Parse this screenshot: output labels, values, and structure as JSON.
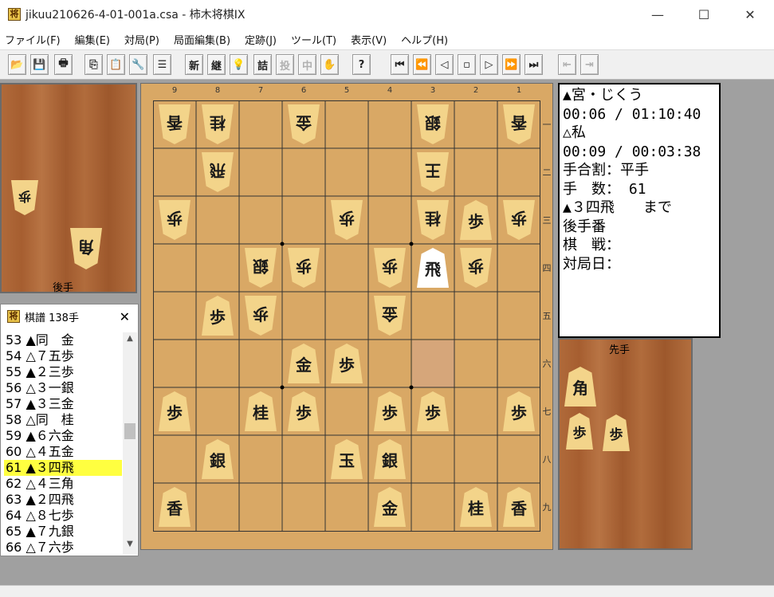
{
  "window": {
    "title": "jikuu210626-4-01-001a.csa - 柿木将棋IX",
    "app_icon": "将",
    "min_glyph": "—",
    "max_glyph": "☐",
    "close_glyph": "✕"
  },
  "menu": [
    "ファイル(F)",
    "編集(E)",
    "対局(P)",
    "局面編集(B)",
    "定跡(J)",
    "ツール(T)",
    "表示(V)",
    "ヘルプ(H)"
  ],
  "toolbar": {
    "buttons": [
      {
        "name": "open-icon",
        "glyph": "📂",
        "enabled": true
      },
      {
        "name": "save-icon",
        "glyph": "💾",
        "enabled": true
      },
      {
        "name": "print-icon",
        "glyph": "🖶",
        "enabled": true
      },
      {
        "name": "copy-icon",
        "glyph": "⎘",
        "enabled": true
      },
      {
        "name": "paste-icon",
        "glyph": "📋",
        "enabled": true
      },
      {
        "name": "tools-icon",
        "glyph": "🔧",
        "enabled": true
      },
      {
        "name": "list-icon",
        "glyph": "☰",
        "enabled": true
      },
      {
        "name": "new-game-button",
        "glyph": "新",
        "enabled": true
      },
      {
        "name": "continue-button",
        "glyph": "継",
        "enabled": true
      },
      {
        "name": "hint-icon",
        "glyph": "💡",
        "enabled": true
      },
      {
        "name": "tsume-button",
        "glyph": "詰",
        "enabled": true
      },
      {
        "name": "resign-button",
        "glyph": "投",
        "enabled": false
      },
      {
        "name": "interrupt-button",
        "glyph": "中",
        "enabled": false
      },
      {
        "name": "hand-icon",
        "glyph": "✋",
        "enabled": false
      },
      {
        "name": "help-icon",
        "glyph": "?",
        "enabled": true
      },
      {
        "name": "first-move-icon",
        "glyph": "⏮",
        "enabled": true
      },
      {
        "name": "back-many-icon",
        "glyph": "⏪",
        "enabled": true
      },
      {
        "name": "back-one-icon",
        "glyph": "◁",
        "enabled": true
      },
      {
        "name": "stop-icon",
        "glyph": "▫",
        "enabled": true
      },
      {
        "name": "forward-one-icon",
        "glyph": "▷",
        "enabled": true
      },
      {
        "name": "forward-many-icon",
        "glyph": "⏩",
        "enabled": true
      },
      {
        "name": "last-move-icon",
        "glyph": "⏭",
        "enabled": true
      },
      {
        "name": "branch-back-icon",
        "glyph": "⇤",
        "enabled": false
      },
      {
        "name": "branch-forward-icon",
        "glyph": "⇥",
        "enabled": false
      }
    ]
  },
  "gote_stand": {
    "label": "後手",
    "pieces": [
      "歩",
      "角"
    ]
  },
  "sente_stand": {
    "label": "先手",
    "pieces": [
      "角",
      "歩",
      "歩"
    ]
  },
  "kifu": {
    "title": "棋譜 138手",
    "icon": "将",
    "close_glyph": "✕",
    "up_glyph": "▲",
    "down_glyph": "▼",
    "selected_index": 8,
    "moves": [
      "53 ▲同　金",
      "54 △７五歩",
      "55 ▲２三歩",
      "56 △３一銀",
      "57 ▲３三金",
      "58 △同　桂",
      "59 ▲６六金",
      "60 △４五金",
      "61 ▲３四飛",
      "62 △４三角",
      "63 ▲２四飛",
      "64 △８七歩",
      "65 ▲７九銀",
      "66 △７六歩"
    ]
  },
  "board": {
    "file_labels": [
      "9",
      "8",
      "7",
      "6",
      "5",
      "4",
      "3",
      "2",
      "1"
    ],
    "rank_labels": [
      "一",
      "二",
      "三",
      "四",
      "五",
      "六",
      "七",
      "八",
      "九"
    ],
    "highlight_square": {
      "file": 3,
      "rank": 6
    },
    "pieces": [
      {
        "file": 9,
        "rank": 1,
        "kanji": "香",
        "side": "gote"
      },
      {
        "file": 8,
        "rank": 1,
        "kanji": "桂",
        "side": "gote"
      },
      {
        "file": 6,
        "rank": 1,
        "kanji": "金",
        "side": "gote"
      },
      {
        "file": 3,
        "rank": 1,
        "kanji": "銀",
        "side": "gote"
      },
      {
        "file": 1,
        "rank": 1,
        "kanji": "香",
        "side": "gote"
      },
      {
        "file": 8,
        "rank": 2,
        "kanji": "飛",
        "side": "gote"
      },
      {
        "file": 3,
        "rank": 2,
        "kanji": "王",
        "side": "gote"
      },
      {
        "file": 9,
        "rank": 3,
        "kanji": "歩",
        "side": "gote"
      },
      {
        "file": 5,
        "rank": 3,
        "kanji": "歩",
        "side": "gote"
      },
      {
        "file": 3,
        "rank": 3,
        "kanji": "桂",
        "side": "gote"
      },
      {
        "file": 2,
        "rank": 3,
        "kanji": "歩",
        "side": "sente"
      },
      {
        "file": 1,
        "rank": 3,
        "kanji": "歩",
        "side": "gote"
      },
      {
        "file": 7,
        "rank": 4,
        "kanji": "銀",
        "side": "gote"
      },
      {
        "file": 6,
        "rank": 4,
        "kanji": "歩",
        "side": "gote"
      },
      {
        "file": 4,
        "rank": 4,
        "kanji": "歩",
        "side": "gote"
      },
      {
        "file": 3,
        "rank": 4,
        "kanji": "飛",
        "side": "sente",
        "highlight": true
      },
      {
        "file": 2,
        "rank": 4,
        "kanji": "歩",
        "side": "gote"
      },
      {
        "file": 8,
        "rank": 5,
        "kanji": "歩",
        "side": "sente"
      },
      {
        "file": 7,
        "rank": 5,
        "kanji": "歩",
        "side": "gote"
      },
      {
        "file": 4,
        "rank": 5,
        "kanji": "金",
        "side": "gote"
      },
      {
        "file": 6,
        "rank": 6,
        "kanji": "金",
        "side": "sente"
      },
      {
        "file": 5,
        "rank": 6,
        "kanji": "歩",
        "side": "sente"
      },
      {
        "file": 9,
        "rank": 7,
        "kanji": "歩",
        "side": "sente"
      },
      {
        "file": 7,
        "rank": 7,
        "kanji": "桂",
        "side": "sente"
      },
      {
        "file": 6,
        "rank": 7,
        "kanji": "歩",
        "side": "sente"
      },
      {
        "file": 4,
        "rank": 7,
        "kanji": "歩",
        "side": "sente"
      },
      {
        "file": 3,
        "rank": 7,
        "kanji": "歩",
        "side": "sente"
      },
      {
        "file": 1,
        "rank": 7,
        "kanji": "歩",
        "side": "sente"
      },
      {
        "file": 8,
        "rank": 8,
        "kanji": "銀",
        "side": "sente"
      },
      {
        "file": 5,
        "rank": 8,
        "kanji": "玉",
        "side": "sente"
      },
      {
        "file": 4,
        "rank": 8,
        "kanji": "銀",
        "side": "sente"
      },
      {
        "file": 9,
        "rank": 9,
        "kanji": "香",
        "side": "sente"
      },
      {
        "file": 4,
        "rank": 9,
        "kanji": "金",
        "side": "sente"
      },
      {
        "file": 2,
        "rank": 9,
        "kanji": "桂",
        "side": "sente"
      },
      {
        "file": 1,
        "rank": 9,
        "kanji": "香",
        "side": "sente"
      }
    ]
  },
  "info": {
    "lines": [
      "▲宮・じくう",
      "00:06 / 01:10:40",
      "△私",
      "00:09 / 00:03:38",
      "手合割：平手",
      "手　数： 61",
      "▲３四飛　　まで",
      "後手番",
      "棋　戦：",
      "対局日："
    ]
  },
  "colors": {
    "board": "#d9a865",
    "piece": "#f3d48a",
    "selected_row": "#ffff40",
    "last_move_square": "#d6a67a"
  }
}
